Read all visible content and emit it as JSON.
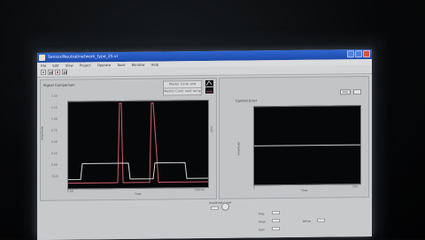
{
  "window": {
    "title": "Sensor/Neutral/network_type_25.vi"
  },
  "menu": [
    {
      "label": "File"
    },
    {
      "label": "Edit"
    },
    {
      "label": "View"
    },
    {
      "label": "Project"
    },
    {
      "label": "Operate"
    },
    {
      "label": "Tools"
    },
    {
      "label": "Window"
    },
    {
      "label": "Help"
    }
  ],
  "left_panel": {
    "title": "Signal Comparison",
    "legend": [
      {
        "label": "Master Contr and Samples",
        "color": "#d7d7d7"
      },
      {
        "label": "Master Contr next temp",
        "color": "#cf5f73"
      }
    ],
    "y_title": "Amplitude",
    "x_title": "Time",
    "x_start": "0.00",
    "x_end": "100.00",
    "y_ticks": [
      "1.50",
      "1.25",
      "1.00",
      "0.75",
      "0.50",
      "0.25",
      "0.00",
      "-0.25"
    ]
  },
  "right_panel": {
    "title": "Control Error",
    "button_label": "Plot",
    "y_title": "Amplitude",
    "x_title": "Time",
    "x_start": "0",
    "x_end": "100"
  },
  "bottom": {
    "labels": [
      "Amplitude Cutoff",
      "Freq",
      "Ampl",
      "Gain",
      "Offset"
    ]
  },
  "colors": {
    "trace_white": "#d7d7d7",
    "trace_red": "#cf5f73",
    "trace_right": "#cfcfcf",
    "plot_bg": "#060708",
    "titlebar": "#2458c2"
  }
}
